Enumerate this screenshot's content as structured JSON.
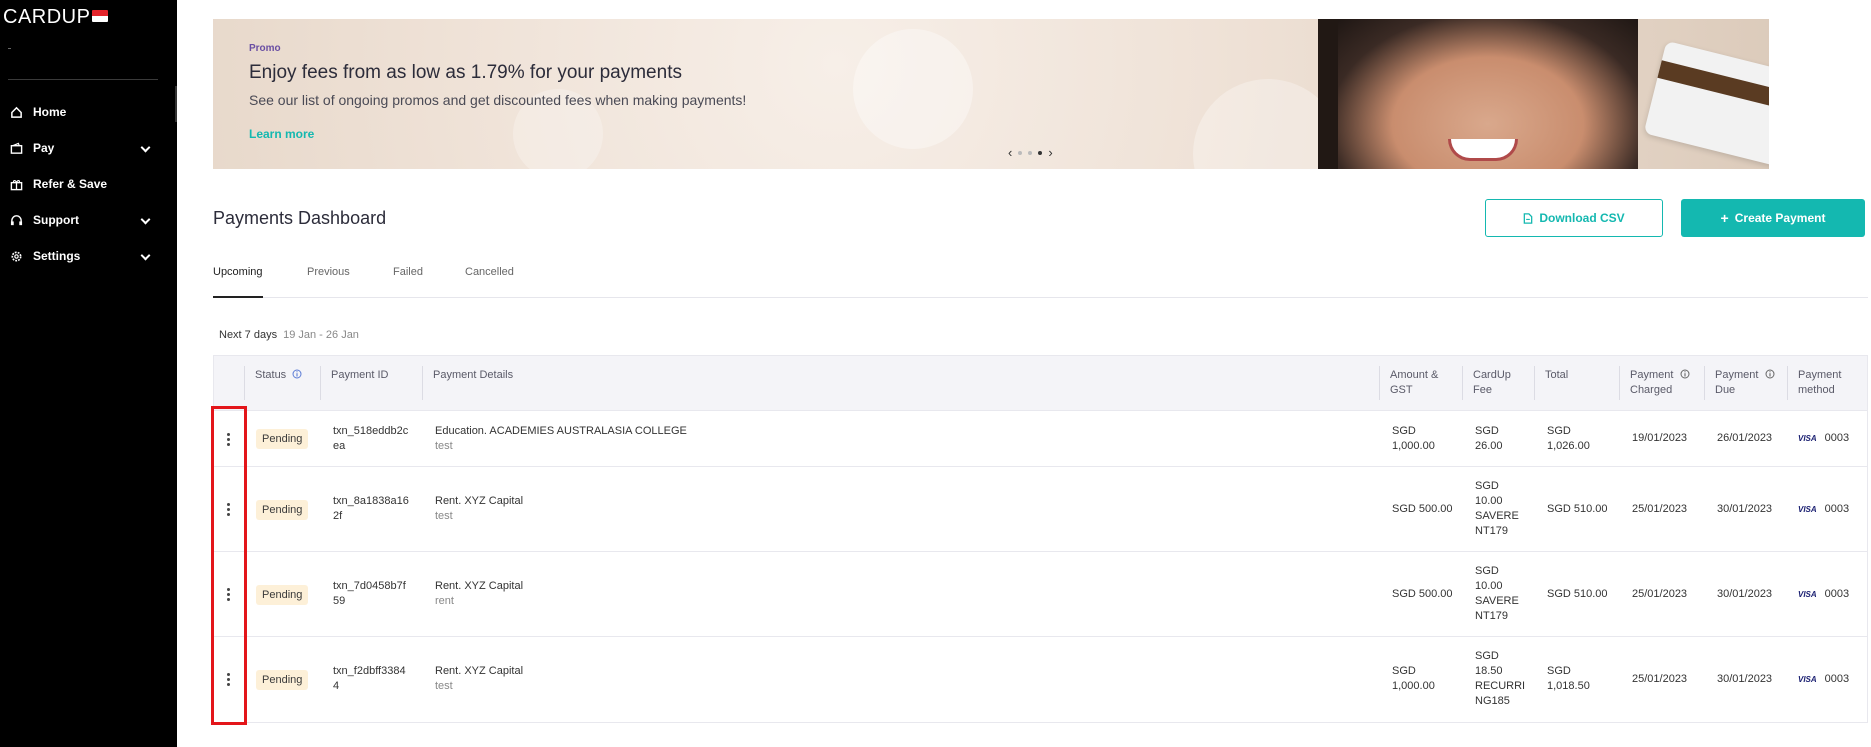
{
  "sidebar": {
    "logo": "CARDUP",
    "items": [
      {
        "label": "Home",
        "icon": "home-icon"
      },
      {
        "label": "Pay",
        "icon": "wallet-icon"
      },
      {
        "label": "Refer & Save",
        "icon": "gift-icon"
      },
      {
        "label": "Support",
        "icon": "headset-icon"
      },
      {
        "label": "Settings",
        "icon": "gear-icon"
      }
    ]
  },
  "banner": {
    "tag": "Promo",
    "title": "Enjoy fees from as low as 1.79% for your payments",
    "subtitle": "See our list of ongoing promos and get discounted fees when making payments!",
    "link": "Learn more",
    "prev": "‹",
    "next": "›"
  },
  "page": {
    "title": "Payments Dashboard",
    "download_csv": "Download CSV",
    "create_payment": "Create Payment"
  },
  "tabs": [
    "Upcoming",
    "Previous",
    "Failed",
    "Cancelled"
  ],
  "range": {
    "label": "Next 7 days",
    "dates": "19 Jan - 26 Jan"
  },
  "table": {
    "headers": {
      "status": "Status",
      "payment_id": "Payment ID",
      "details": "Payment Details",
      "amount_1": "Amount &",
      "amount_2": "GST",
      "fee_1": "CardUp",
      "fee_2": "Fee",
      "total": "Total",
      "charged_1": "Payment",
      "charged_2": "Charged",
      "due_1": "Payment",
      "due_2": "Due",
      "method_1": "Payment",
      "method_2": "method"
    },
    "rows": [
      {
        "status": "Pending",
        "id_1": "txn_518eddb2c",
        "id_2": "ea",
        "details": "Education. ACADEMIES AUSTRALASIA COLLEGE",
        "note": "test",
        "amount_1": "SGD",
        "amount_2": "1,000.00",
        "fee_1": "SGD",
        "fee_2": "26.00",
        "fee_3": "",
        "fee_4": "",
        "total_1": "SGD",
        "total_2": "1,026.00",
        "charged": "19/01/2023",
        "due": "26/01/2023",
        "card_brand": "VISA",
        "card_last4": "0003"
      },
      {
        "status": "Pending",
        "id_1": "txn_8a1838a16",
        "id_2": "2f",
        "details": "Rent. XYZ Capital",
        "note": "test",
        "amount_1": "SGD 500.00",
        "amount_2": "",
        "fee_1": "SGD",
        "fee_2": "10.00",
        "fee_3": "SAVERE",
        "fee_4": "NT179",
        "total_1": "SGD 510.00",
        "total_2": "",
        "charged": "25/01/2023",
        "due": "30/01/2023",
        "card_brand": "VISA",
        "card_last4": "0003"
      },
      {
        "status": "Pending",
        "id_1": "txn_7d0458b7f",
        "id_2": "59",
        "details": "Rent. XYZ Capital",
        "note": "rent",
        "amount_1": "SGD 500.00",
        "amount_2": "",
        "fee_1": "SGD",
        "fee_2": "10.00",
        "fee_3": "SAVERE",
        "fee_4": "NT179",
        "total_1": "SGD 510.00",
        "total_2": "",
        "charged": "25/01/2023",
        "due": "30/01/2023",
        "card_brand": "VISA",
        "card_last4": "0003"
      },
      {
        "status": "Pending",
        "id_1": "txn_f2dbff3384",
        "id_2": "4",
        "details": "Rent. XYZ Capital",
        "note": "test",
        "amount_1": "SGD",
        "amount_2": "1,000.00",
        "fee_1": "SGD",
        "fee_2": "18.50",
        "fee_3": "RECURRI",
        "fee_4": "NG185",
        "total_1": "SGD",
        "total_2": "1,018.50",
        "charged": "25/01/2023",
        "due": "30/01/2023",
        "card_brand": "VISA",
        "card_last4": "0003"
      }
    ]
  },
  "colors": {
    "accent": "#14b8b0",
    "highlight": "#e3151a",
    "badge_bg": "#fdf0d8"
  }
}
